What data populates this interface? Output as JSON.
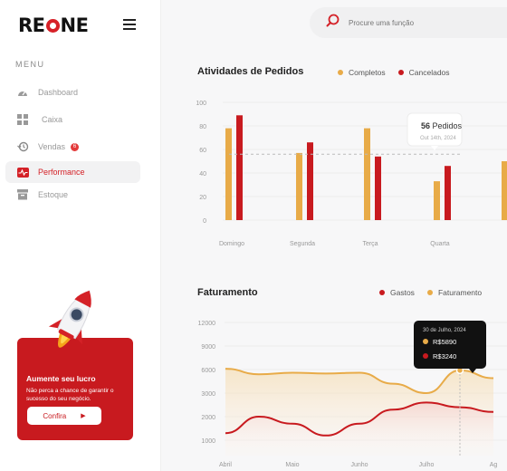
{
  "brand": {
    "name_left": "RE",
    "name_right": "NE"
  },
  "sidebar": {
    "menu_title": "MENU",
    "items": [
      {
        "label": "Dashboard",
        "icon": "gauge-icon"
      },
      {
        "label": "Caixa",
        "icon": "grid-icon"
      },
      {
        "label": "Vendas",
        "icon": "history-icon",
        "badge": "6"
      },
      {
        "label": "Performance",
        "icon": "pulse-icon",
        "active": true
      },
      {
        "label": "Estoque",
        "icon": "archive-icon"
      }
    ],
    "promo": {
      "title": "Aumente seu lucro",
      "text": "Não perca a chance de garantir o sucesso do seu negócio.",
      "button": "Confira"
    }
  },
  "search": {
    "placeholder": "Procure uma função"
  },
  "colors": {
    "accent": "#d42127",
    "orange": "#e8ab48",
    "red": "#c81a1f"
  },
  "orders": {
    "title": "Atividades de Pedidos",
    "legend": [
      "Completos",
      "Cancelados"
    ],
    "tooltip": {
      "value": "56",
      "unit": "Pedidos",
      "date": "Out 14th, 2024"
    }
  },
  "revenue": {
    "title": "Faturamento",
    "legend": [
      "Gastos",
      "Faturamento"
    ],
    "tooltip": {
      "date": "30 de Julho, 2024",
      "faturamento": "R$5890",
      "gastos": "R$3240"
    }
  },
  "chart_data": [
    {
      "type": "bar",
      "title": "Atividades de Pedidos",
      "categories": [
        "Domingo",
        "Segunda",
        "Terça",
        "Quarta"
      ],
      "series": [
        {
          "name": "Completos",
          "values": [
            78,
            57,
            78,
            33
          ]
        },
        {
          "name": "Cancelados",
          "values": [
            89,
            66,
            54,
            46
          ]
        }
      ],
      "yticks": [
        0,
        20,
        40,
        60,
        80,
        100
      ],
      "ylim": [
        0,
        100
      ],
      "reference_line": 56
    },
    {
      "type": "area",
      "title": "Faturamento",
      "categories": [
        "Abril",
        "Maio",
        "Junho",
        "Julho",
        "Ag"
      ],
      "series": [
        {
          "name": "Faturamento",
          "x": [
            0,
            0.5,
            1,
            1.5,
            2,
            2.5,
            3,
            3.5,
            4
          ],
          "values": [
            6100,
            5400,
            5600,
            5500,
            5600,
            4200,
            3000,
            5900,
            4900
          ]
        },
        {
          "name": "Gastos",
          "x": [
            0,
            0.5,
            1,
            1.5,
            2,
            2.5,
            3,
            3.5,
            4
          ],
          "values": [
            1300,
            2000,
            1700,
            1200,
            1700,
            2300,
            2600,
            2400,
            2200
          ]
        }
      ],
      "yticks": [
        1000,
        2000,
        3000,
        4000,
        6000,
        9000,
        12000
      ],
      "ylim": [
        0,
        12000
      ],
      "highlight_index": 7
    }
  ]
}
